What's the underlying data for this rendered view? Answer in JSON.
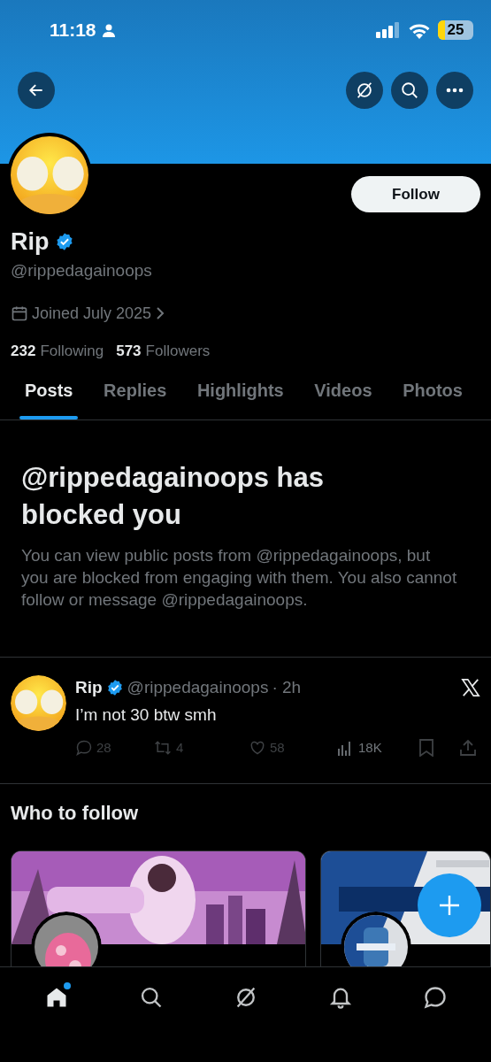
{
  "status_bar": {
    "time": "11:18",
    "battery": "25"
  },
  "profile": {
    "name": "Rip",
    "verified": true,
    "handle": "@rippedagainoops",
    "joined": "Joined July 2025",
    "following_count": "232",
    "following_label": "Following",
    "followers_count": "573",
    "followers_label": "Followers",
    "follow_button": "Follow"
  },
  "tabs": [
    {
      "label": "Posts",
      "selected": true
    },
    {
      "label": "Replies",
      "selected": false
    },
    {
      "label": "Highlights",
      "selected": false
    },
    {
      "label": "Videos",
      "selected": false
    },
    {
      "label": "Photos",
      "selected": false
    }
  ],
  "blocked_notice": {
    "title": "@rippedagainoops has blocked you",
    "body": "You can view public posts from @rippedagainoops, but you are blocked from engaging with them. You also cannot follow or message @rippedagainoops."
  },
  "post": {
    "name": "Rip",
    "verified": true,
    "handle": "@rippedagainoops",
    "time": "· 2h",
    "text": "I’m not 30 btw smh",
    "replies": "28",
    "reposts": "4",
    "likes": "58",
    "views": "18K"
  },
  "who_to_follow": {
    "title": "Who to follow"
  },
  "bottom_nav": [
    {
      "kind": "home",
      "selected": true,
      "dot": true
    },
    {
      "kind": "search",
      "selected": false,
      "dot": false
    },
    {
      "kind": "grok",
      "selected": false,
      "dot": false
    },
    {
      "kind": "notifications",
      "selected": false,
      "dot": false
    },
    {
      "kind": "messages",
      "selected": false,
      "dot": false
    }
  ]
}
